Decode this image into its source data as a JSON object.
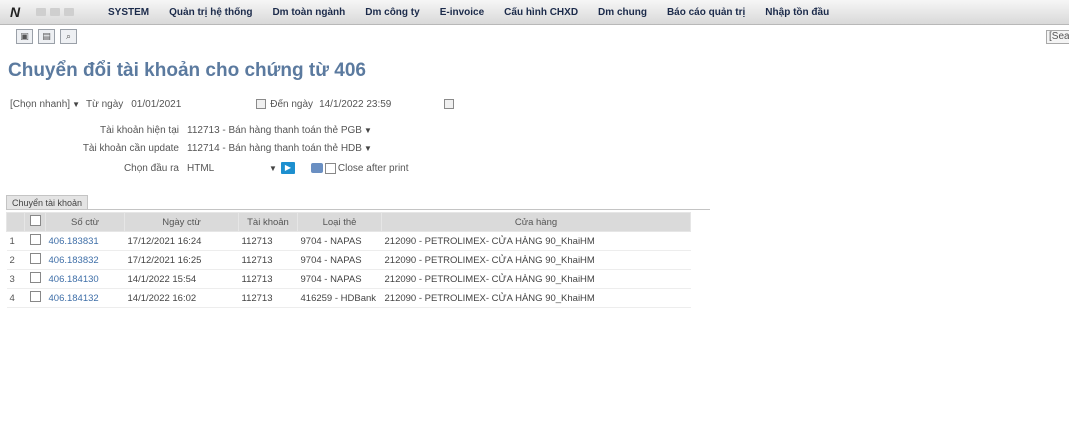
{
  "menubar": {
    "items": [
      "SYSTEM",
      "Quản trị hệ thống",
      "Dm toàn ngành",
      "Dm công ty",
      "E-invoice",
      "Cấu hình CHXD",
      "Dm chung",
      "Báo cáo quản trị",
      "Nhập tồn đầu"
    ],
    "logo_icon": "app-logo-icon"
  },
  "toolbar": {
    "icons": [
      "new-document-icon",
      "open-document-icon",
      "search-document-icon"
    ],
    "search_placeholder": "[Search"
  },
  "page": {
    "title": "Chuyển đổi tài khoản cho chứng từ 406"
  },
  "form": {
    "quick_select": "[Chọn nhanh]",
    "from_date_label": "Từ ngày",
    "from_date_value": "01/01/2021",
    "to_date_label": "Đến ngày",
    "to_date_value": "14/1/2022 23:59",
    "current_account_label": "Tài khoản hiện tại",
    "current_account_value": "112713 - Bán hàng thanh toán thẻ PGB",
    "update_account_label": "Tài khoản cần update",
    "update_account_value": "112714 - Bán hàng thanh toán thẻ HDB",
    "output_label": "Chọn đầu ra",
    "output_value": "HTML",
    "close_after_print_label": "Close after print"
  },
  "tab": {
    "label": "Chuyển tài khoản"
  },
  "table": {
    "columns": [
      "Số ctừ",
      "Ngày ctừ",
      "Tài khoản",
      "Loại thẻ",
      "Cửa hàng"
    ],
    "rows": [
      {
        "idx": "1",
        "so_ctu": "406.183831",
        "ngay_ctu": "17/12/2021 16:24",
        "tai_khoan": "112713",
        "loai_the": "9704 - NAPAS",
        "cua_hang": "212090 - PETROLIMEX- CỬA HÀNG 90_KhaiHM"
      },
      {
        "idx": "2",
        "so_ctu": "406.183832",
        "ngay_ctu": "17/12/2021 16:25",
        "tai_khoan": "112713",
        "loai_the": "9704 - NAPAS",
        "cua_hang": "212090 - PETROLIMEX- CỬA HÀNG 90_KhaiHM"
      },
      {
        "idx": "3",
        "so_ctu": "406.184130",
        "ngay_ctu": "14/1/2022 15:54",
        "tai_khoan": "112713",
        "loai_the": "9704 - NAPAS",
        "cua_hang": "212090 - PETROLIMEX- CỬA HÀNG 90_KhaiHM"
      },
      {
        "idx": "4",
        "so_ctu": "406.184132",
        "ngay_ctu": "14/1/2022 16:02",
        "tai_khoan": "112713",
        "loai_the": "416259 - HDBank",
        "cua_hang": "212090 - PETROLIMEX- CỬA HÀNG 90_KhaiHM"
      }
    ]
  },
  "colors": {
    "title": "#5b7a9f",
    "link": "#3f6fa8",
    "header_bg": "#dadada",
    "go_button": "#1d8fcf"
  }
}
